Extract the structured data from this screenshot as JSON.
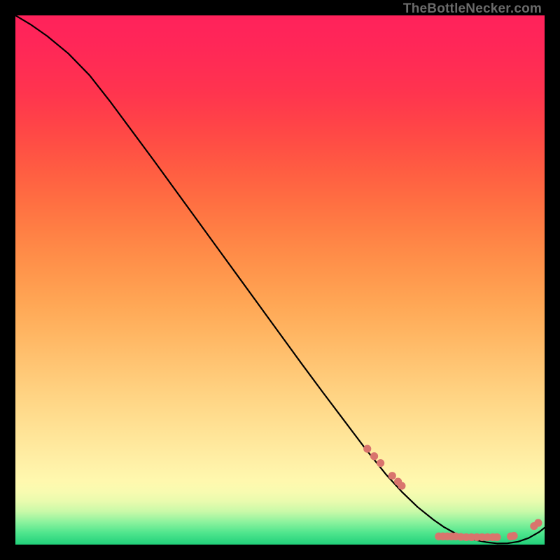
{
  "watermark": "TheBottleNecker.com",
  "colors": {
    "dot": "#d9746d",
    "curve": "#000000",
    "frame": "#000000"
  },
  "chart_data": {
    "type": "line",
    "title": "",
    "xlabel": "",
    "ylabel": "",
    "xlim": [
      0,
      100
    ],
    "ylim": [
      0,
      100
    ],
    "legend": false,
    "grid": false,
    "background": "gradient-red-yellow-green",
    "series": [
      {
        "name": "bottleneck-curve",
        "x": [
          0,
          3,
          6,
          10,
          14,
          18,
          22,
          26,
          30,
          34,
          38,
          42,
          46,
          50,
          54,
          58,
          62,
          66,
          70,
          73,
          76,
          79,
          81,
          83,
          85,
          87,
          89,
          91,
          93,
          95,
          97,
          99,
          100
        ],
        "y": [
          100,
          98.2,
          96.1,
          92.8,
          88.7,
          83.6,
          78.2,
          72.8,
          67.3,
          61.8,
          56.3,
          50.8,
          45.3,
          39.8,
          34.3,
          28.9,
          23.6,
          18.3,
          13.3,
          10.0,
          7.1,
          4.7,
          3.3,
          2.2,
          1.4,
          0.85,
          0.45,
          0.22,
          0.25,
          0.55,
          1.25,
          2.4,
          3.2
        ]
      }
    ],
    "markers": [
      {
        "x": 66.5,
        "y": 18.1
      },
      {
        "x": 67.8,
        "y": 16.7
      },
      {
        "x": 69.0,
        "y": 15.4
      },
      {
        "x": 71.2,
        "y": 13.0
      },
      {
        "x": 72.3,
        "y": 11.9
      },
      {
        "x": 73.0,
        "y": 11.1
      },
      {
        "x": 80.0,
        "y": 1.55
      },
      {
        "x": 80.8,
        "y": 1.55
      },
      {
        "x": 81.6,
        "y": 1.55
      },
      {
        "x": 82.4,
        "y": 1.55
      },
      {
        "x": 83.2,
        "y": 1.55
      },
      {
        "x": 84.2,
        "y": 1.45
      },
      {
        "x": 85.2,
        "y": 1.4
      },
      {
        "x": 86.2,
        "y": 1.4
      },
      {
        "x": 87.2,
        "y": 1.4
      },
      {
        "x": 88.2,
        "y": 1.4
      },
      {
        "x": 89.2,
        "y": 1.4
      },
      {
        "x": 90.2,
        "y": 1.4
      },
      {
        "x": 91.0,
        "y": 1.4
      },
      {
        "x": 93.6,
        "y": 1.55
      },
      {
        "x": 94.2,
        "y": 1.65
      },
      {
        "x": 98.0,
        "y": 3.5
      },
      {
        "x": 98.8,
        "y": 4.1
      }
    ]
  }
}
